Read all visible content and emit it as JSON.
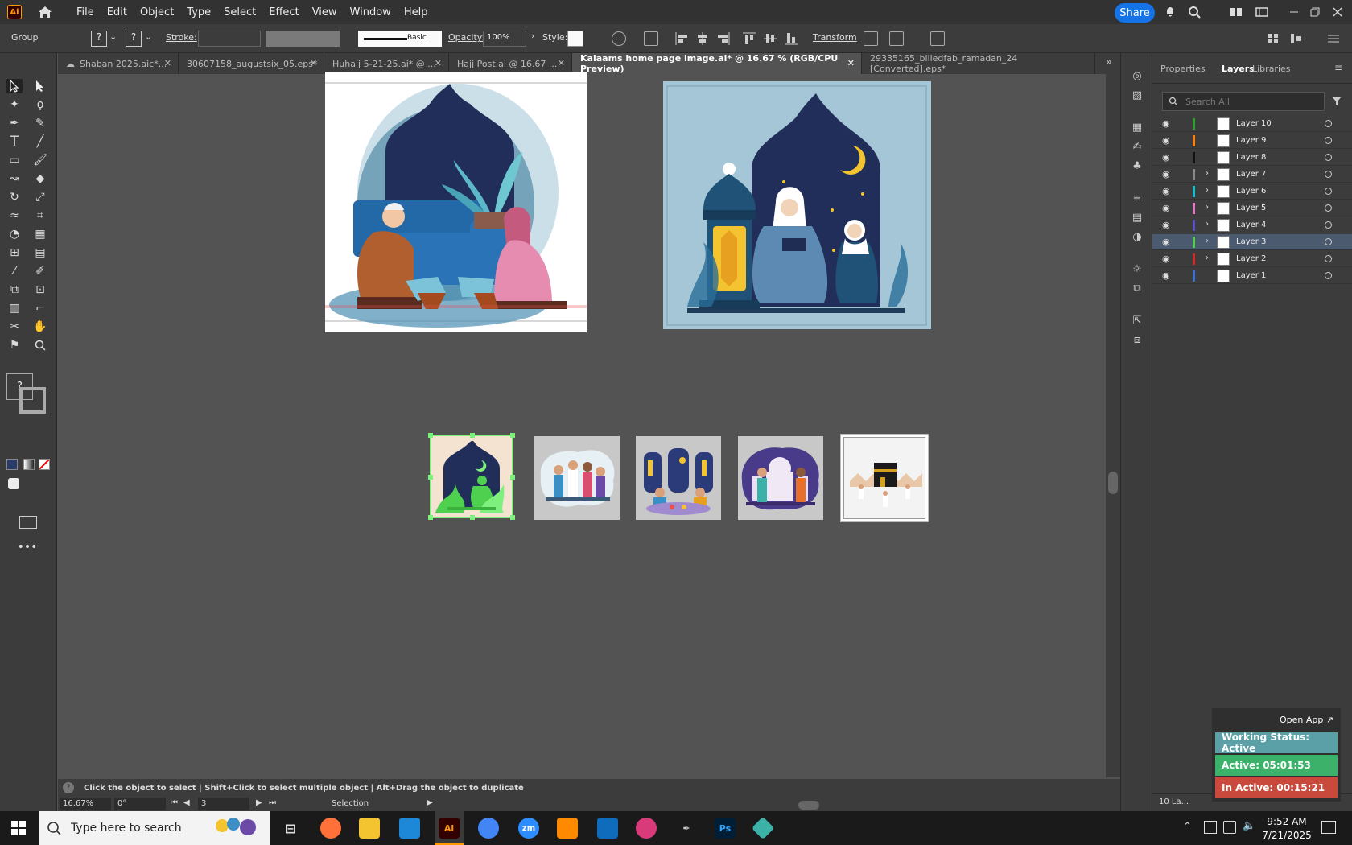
{
  "menubar": {
    "logo": "Ai",
    "items": [
      "File",
      "Edit",
      "Object",
      "Type",
      "Select",
      "Effect",
      "View",
      "Window",
      "Help"
    ],
    "share": "Share"
  },
  "control": {
    "selection_type": "Group",
    "stroke_label": "Stroke:",
    "brush_label": "Basic",
    "opacity_label": "Opacity:",
    "opacity_value": "100%",
    "style_label": "Style:",
    "transform_label": "Transform",
    "q1": "?",
    "q2": "?"
  },
  "tabs": [
    {
      "label": "Shaban 2025.aic*..."
    },
    {
      "label": "30607158_augustsix_05.eps*"
    },
    {
      "label": "Huhajj 5-21-25.ai* @ ..."
    },
    {
      "label": "Hajj Post.ai @ 16.67 ..."
    },
    {
      "label": "Kalaams home page image.ai* @ 16.67 % (RGB/CPU Preview)"
    },
    {
      "label": "29335165_billedfab_ramadan_24 [Converted].eps*"
    }
  ],
  "status": {
    "hint": "Click the object to select  |  Shift+Click to select multiple object  |  Alt+Drag the object to duplicate",
    "zoom": "16.67%",
    "rotation": "0°",
    "artboard": "3",
    "tool": "Selection"
  },
  "panel": {
    "tabs": [
      "Properties",
      "Layers",
      "Libraries"
    ],
    "search_placeholder": "Search All",
    "layers": [
      {
        "name": "Layer 10",
        "color": "#2ca02c",
        "expandable": false,
        "selected": false
      },
      {
        "name": "Layer 9",
        "color": "#ff7f0e",
        "expandable": false,
        "selected": false
      },
      {
        "name": "Layer 8",
        "color": "#111111",
        "expandable": false,
        "selected": false
      },
      {
        "name": "Layer 7",
        "color": "#888888",
        "expandable": true,
        "selected": false
      },
      {
        "name": "Layer 6",
        "color": "#17becf",
        "expandable": true,
        "selected": false
      },
      {
        "name": "Layer 5",
        "color": "#e377c2",
        "expandable": true,
        "selected": false
      },
      {
        "name": "Layer 4",
        "color": "#5b4fcf",
        "expandable": true,
        "selected": false
      },
      {
        "name": "Layer 3",
        "color": "#4fd14f",
        "expandable": true,
        "selected": true
      },
      {
        "name": "Layer 2",
        "color": "#d62728",
        "expandable": true,
        "selected": false
      },
      {
        "name": "Layer 1",
        "color": "#3b6fd6",
        "expandable": false,
        "selected": false
      }
    ],
    "footer": "10 La..."
  },
  "widget": {
    "open_app": "Open App ↗",
    "working": "Working Status: Active",
    "active": "Active: 05:01:53",
    "inactive": "In Active: 00:15:21"
  },
  "taskbar": {
    "search_placeholder": "Type here to search",
    "time": "9:52 AM",
    "date": "7/21/2025",
    "apps": [
      "Ai",
      "Ps",
      "zm"
    ]
  },
  "colors": {
    "accent": "#1473e6",
    "working": "#5aa0a6",
    "active": "#3cb16a",
    "inactive": "#c94a3c"
  }
}
